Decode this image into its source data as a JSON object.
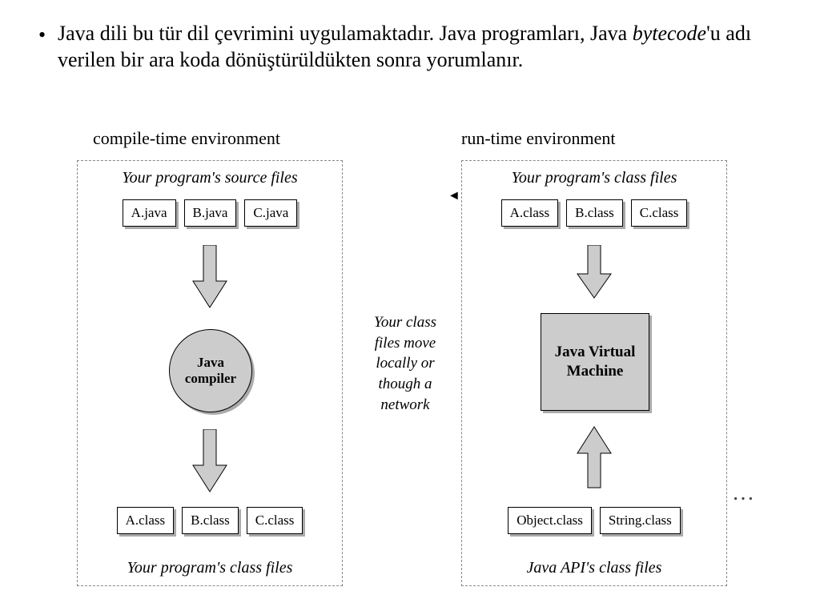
{
  "bullet": {
    "pre": "Java dili bu tür dil çevrimini uygulamaktadır. Java programları, Java ",
    "em": "bytecode",
    "post": "'u adı verilen bir ara koda dönüştürüldükten sonra yorumlanır."
  },
  "left": {
    "title": "compile-time environment",
    "top_caption": "Your program's source files",
    "files_in": [
      "A.java",
      "B.java",
      "C.java"
    ],
    "node": "Java compiler",
    "files_out": [
      "A.class",
      "B.class",
      "C.class"
    ],
    "bottom_caption": "Your program's class files"
  },
  "right": {
    "title": "run-time environment",
    "top_caption": "Your program's class files",
    "files_in": [
      "A.class",
      "B.class",
      "C.class"
    ],
    "node": "Java Virtual Machine",
    "files_out": [
      "Object.class",
      "String.class"
    ],
    "bottom_caption": "Java API's class files"
  },
  "middle": "Your class files move locally or though a network",
  "ellipsis": "…"
}
